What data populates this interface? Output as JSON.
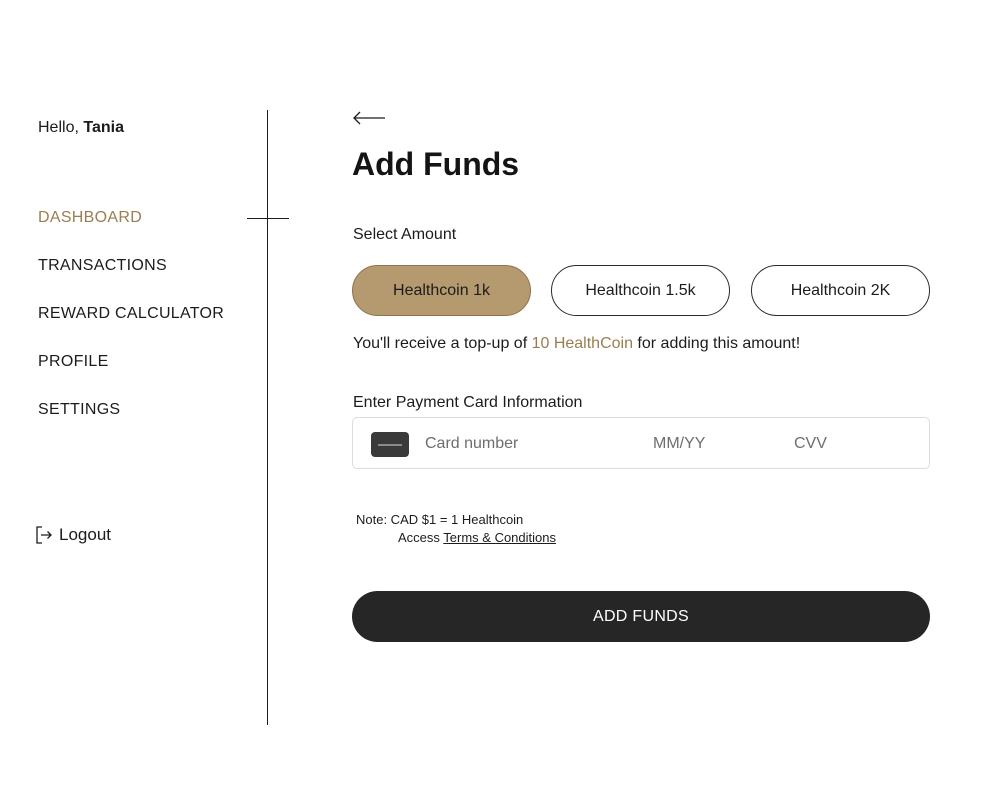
{
  "sidebar": {
    "greeting_prefix": "Hello, ",
    "user_name": "Tania",
    "items": [
      {
        "label": "DASHBOARD",
        "active": true
      },
      {
        "label": "TRANSACTIONS",
        "active": false
      },
      {
        "label": "REWARD CALCULATOR",
        "active": false
      },
      {
        "label": "PROFILE",
        "active": false
      },
      {
        "label": "SETTINGS",
        "active": false
      }
    ],
    "logout_label": "Logout"
  },
  "main": {
    "back_icon": "arrow-left-icon",
    "title": "Add Funds",
    "select_amount_label": "Select Amount",
    "amount_options": [
      {
        "label": "Healthcoin 1k",
        "selected": true
      },
      {
        "label": "Healthcoin 1.5k",
        "selected": false
      },
      {
        "label": "Healthcoin 2K",
        "selected": false
      }
    ],
    "topup": {
      "prefix": "You'll receive a top-up of ",
      "highlight": "10 HealthCoin",
      "suffix": " for adding this amount!"
    },
    "payment_label": "Enter Payment Card Information",
    "card": {
      "number_placeholder": "Card number",
      "expiry_placeholder": "MM/YY",
      "cvv_placeholder": "CVV",
      "icon": "credit-card-icon"
    },
    "note": {
      "line1": "Note: CAD $1 = 1 Healthcoin",
      "line2_prefix": "Access ",
      "terms_link": "Terms & Conditions"
    },
    "submit_label": "ADD FUNDS"
  },
  "colors": {
    "accent": "#9b7e4f",
    "pill_selected": "#b59a6f",
    "button_dark": "#262626"
  }
}
